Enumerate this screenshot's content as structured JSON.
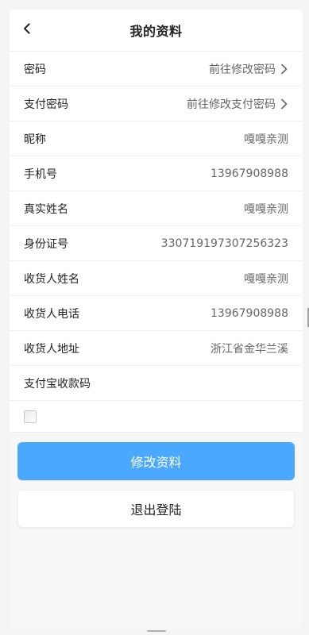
{
  "header": {
    "title": "我的资料",
    "back_icon": "chevron-left-icon"
  },
  "profile": {
    "rows": [
      {
        "key": "password",
        "label": "密码",
        "value": "前往修改密码",
        "chevron": true
      },
      {
        "key": "pay_password",
        "label": "支付密码",
        "value": "前往修改支付密码",
        "chevron": true
      },
      {
        "key": "nickname",
        "label": "昵称",
        "value": "嘎嘎亲测",
        "chevron": false
      },
      {
        "key": "phone",
        "label": "手机号",
        "value": "13967908988",
        "chevron": false
      },
      {
        "key": "real_name",
        "label": "真实姓名",
        "value": "嘎嘎亲测",
        "chevron": false
      },
      {
        "key": "id_number",
        "label": "身份证号",
        "value": "330719197307256323",
        "chevron": false
      },
      {
        "key": "consignee_name",
        "label": "收货人姓名",
        "value": "嘎嘎亲测",
        "chevron": false
      },
      {
        "key": "consignee_phone",
        "label": "收货人电话",
        "value": "13967908988",
        "chevron": false
      },
      {
        "key": "consignee_address",
        "label": "收货人地址",
        "value": "浙江省金华兰溪",
        "chevron": false
      },
      {
        "key": "alipay_code",
        "label": "支付宝收款码",
        "value": "",
        "chevron": false
      }
    ],
    "qr_image_icon": "broken-image-icon"
  },
  "actions": {
    "edit_label": "修改资料",
    "logout_label": "退出登陆"
  },
  "colors": {
    "primary_button": "#4aa8ff",
    "background": "#f5f5f5"
  }
}
